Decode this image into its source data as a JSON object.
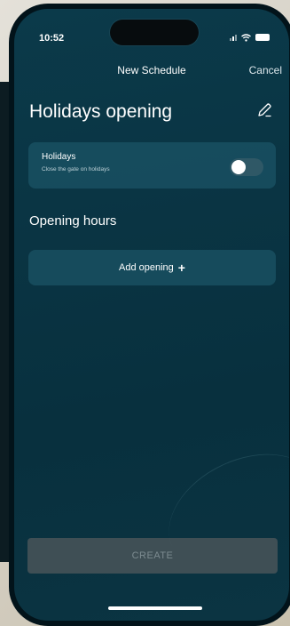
{
  "status_bar": {
    "time": "10:52"
  },
  "nav": {
    "title": "New Schedule",
    "cancel_label": "Cancel"
  },
  "schedule": {
    "name": "Holidays opening"
  },
  "holidays": {
    "label": "Holidays",
    "description": "Close the gate on holidays",
    "enabled": false
  },
  "opening_hours": {
    "section_title": "Opening hours",
    "add_label": "Add opening",
    "add_icon": "plus-icon"
  },
  "footer": {
    "create_label": "CREATE",
    "create_enabled": false
  },
  "colors": {
    "screen_background": "#0a3544",
    "card_background": "#1c5466",
    "button_disabled": "#3f4f55"
  }
}
